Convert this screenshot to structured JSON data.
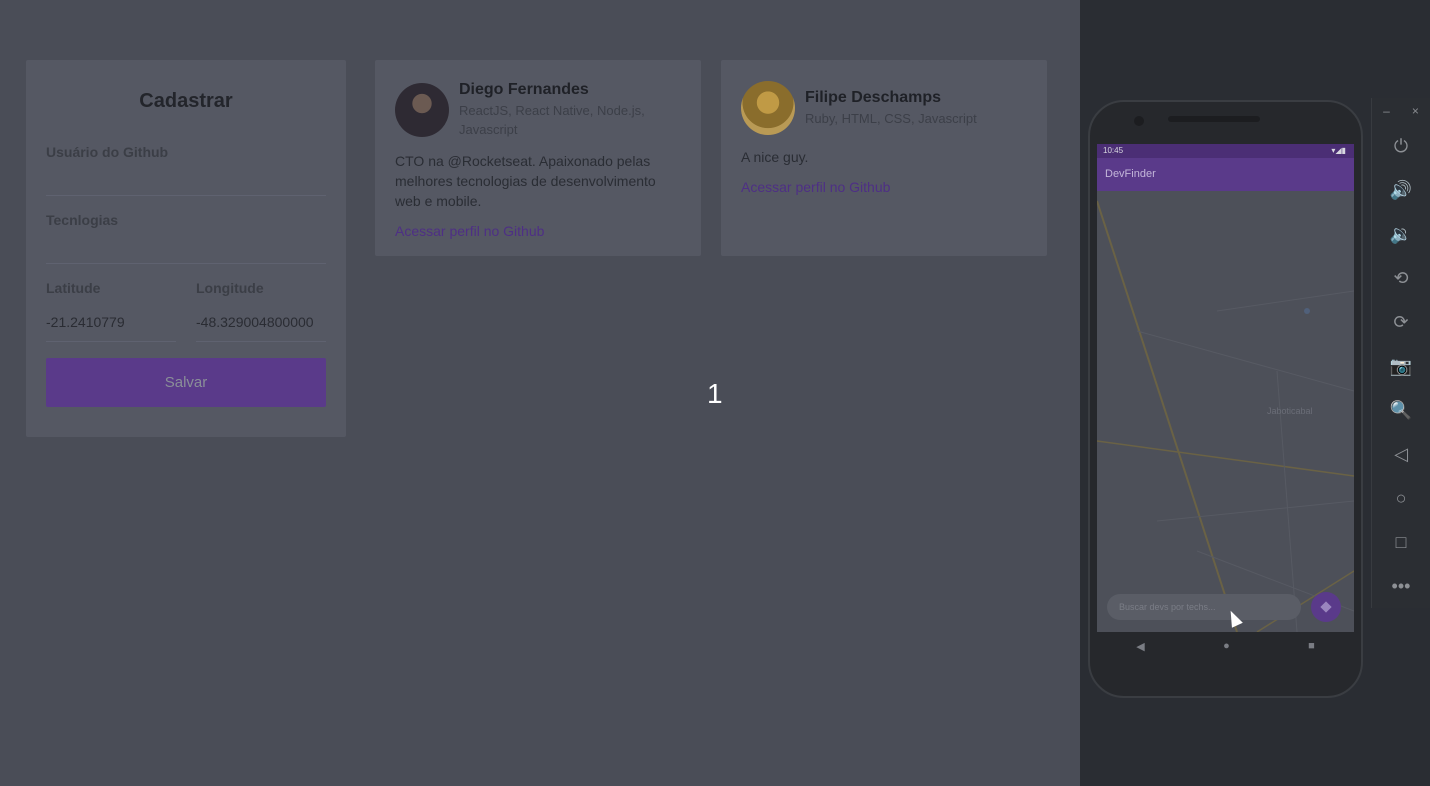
{
  "form": {
    "title": "Cadastrar",
    "github_user_label": "Usuário do Github",
    "github_user_value": "",
    "techs_label": "Tecnlogias",
    "techs_value": "",
    "latitude_label": "Latitude",
    "latitude_value": "-21.2410779",
    "longitude_label": "Longitude",
    "longitude_value": "-48.329004800000",
    "save_label": "Salvar"
  },
  "devs": [
    {
      "name": "Diego Fernandes",
      "techs": "ReactJS, React Native, Node.js, Javascript",
      "bio": "CTO na @Rocketseat. Apaixonado pelas melhores tecnologias de desenvolvimento web e mobile.",
      "link": "Acessar perfil no Github"
    },
    {
      "name": "Filipe Deschamps",
      "techs": "Ruby, HTML, CSS, Javascript",
      "bio": "A nice guy.",
      "link": "Acessar perfil no Github"
    }
  ],
  "overlay_number": "1",
  "emulator": {
    "status_time": "10:45",
    "app_title": "DevFinder",
    "map_city_label": "Jaboticabal",
    "search_placeholder": "Buscar devs por techs...",
    "nav_back": "◀",
    "nav_home": "●",
    "nav_recent": "■",
    "toolbar": {
      "minimize": "–",
      "close": "×",
      "power": "⏻",
      "volume_up": "🔊",
      "volume_down": "🔉",
      "rotate_left": "⟲",
      "rotate_right": "⟳",
      "camera": "📷",
      "zoom": "🔍",
      "back": "◁",
      "home": "○",
      "overview": "□",
      "more": "•••"
    }
  },
  "colors": {
    "page_bg": "#4a4d57",
    "card_bg": "#555863",
    "primary": "#5a3a8a",
    "link": "#4e2f85",
    "emulator_bg": "#2a2d33"
  }
}
